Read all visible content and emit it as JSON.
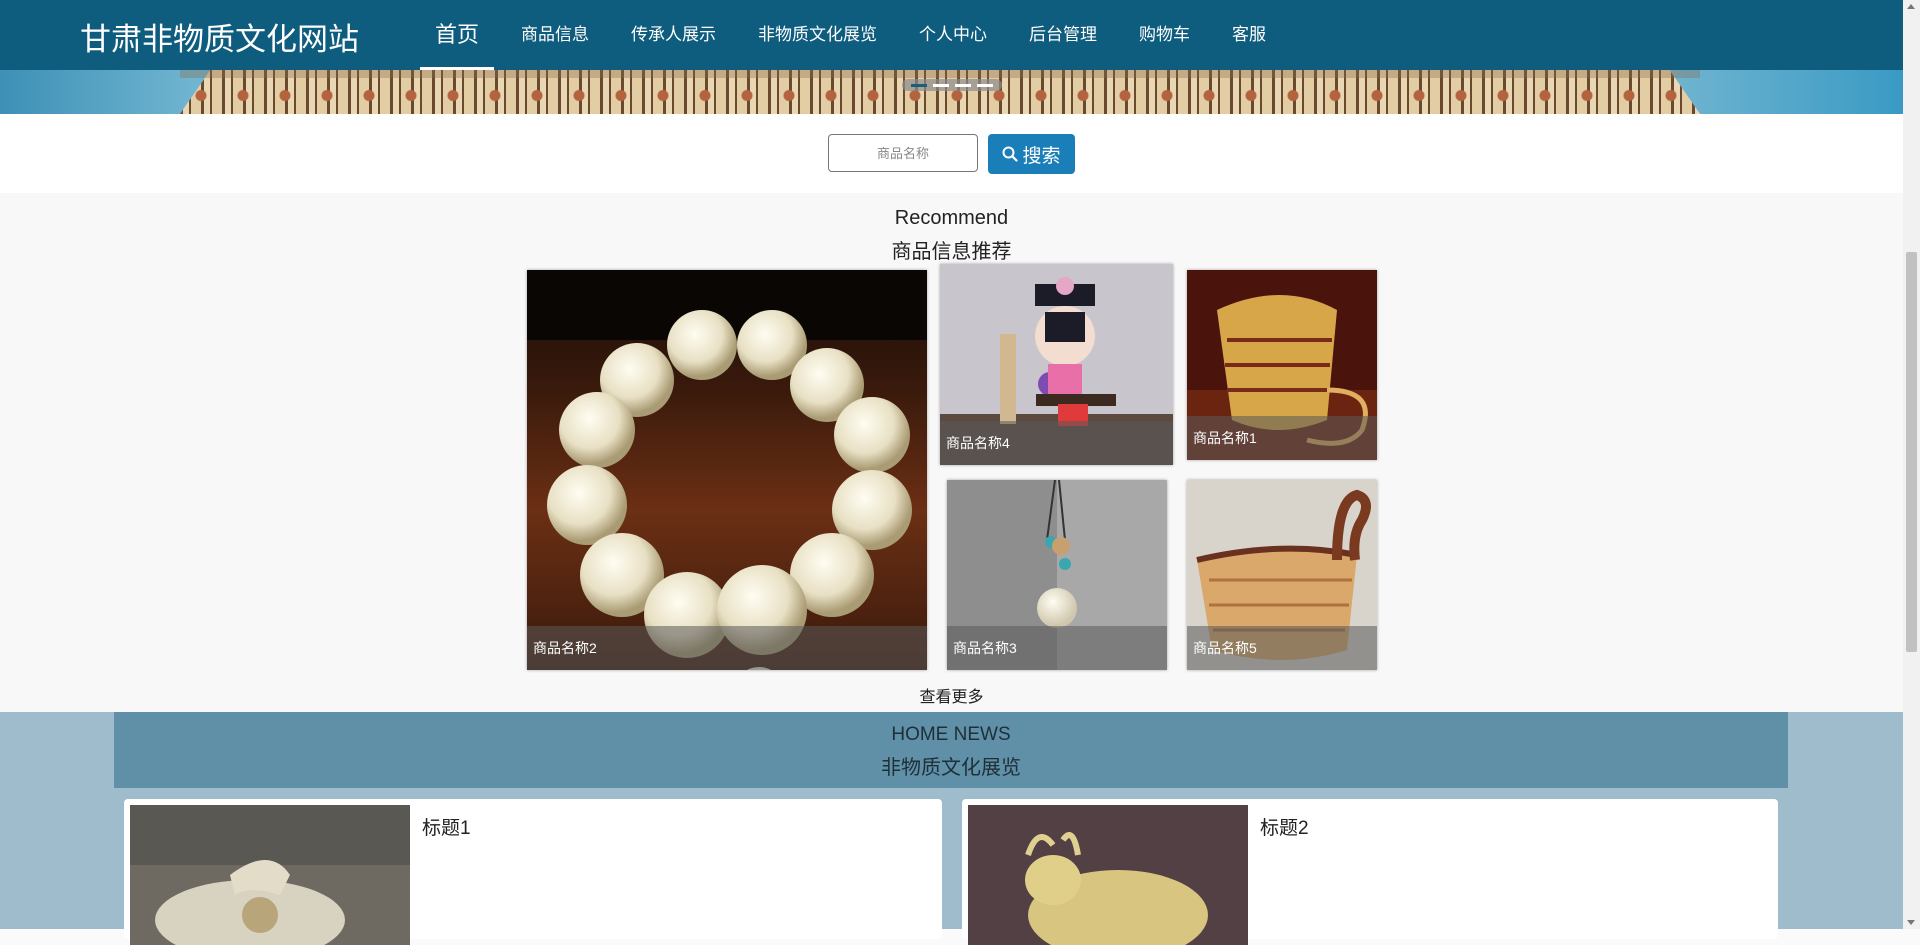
{
  "site": {
    "title": "甘肃非物质文化网站"
  },
  "nav": [
    {
      "label": "首页",
      "active": true
    },
    {
      "label": "商品信息"
    },
    {
      "label": "传承人展示"
    },
    {
      "label": "非物质文化展览"
    },
    {
      "label": "个人中心"
    },
    {
      "label": "后台管理"
    },
    {
      "label": "购物车"
    },
    {
      "label": "客服"
    }
  ],
  "banner": {
    "slide_count": 4,
    "active_slide": 1
  },
  "search": {
    "placeholder": "商品名称",
    "button_label": "搜索",
    "icon": "search-icon"
  },
  "recommend": {
    "title_en": "Recommend",
    "title_cn": "商品信息推荐",
    "items": [
      {
        "name": "商品名称2",
        "image": "bodhi-bead-bracelet"
      },
      {
        "name": "商品名称4",
        "image": "qing-princess-doll-figurine"
      },
      {
        "name": "商品名称1",
        "image": "woven-bamboo-basket"
      },
      {
        "name": "商品名称3",
        "image": "bead-pendant-necklace"
      },
      {
        "name": "商品名称5",
        "image": "woven-duck-basket"
      }
    ],
    "view_more": "查看更多"
  },
  "news": {
    "title_en": "HOME NEWS",
    "title_cn": "非物质文化展览",
    "items": [
      {
        "title": "标题1",
        "image": "white-jade-animal-carving"
      },
      {
        "title": "标题2",
        "image": "tricolor-glazed-ox"
      }
    ]
  },
  "colors": {
    "header": "#0e5c7e",
    "accent": "#1a7fb8",
    "news_bg": "#9ebccb",
    "news_head": "#5f90a8"
  }
}
